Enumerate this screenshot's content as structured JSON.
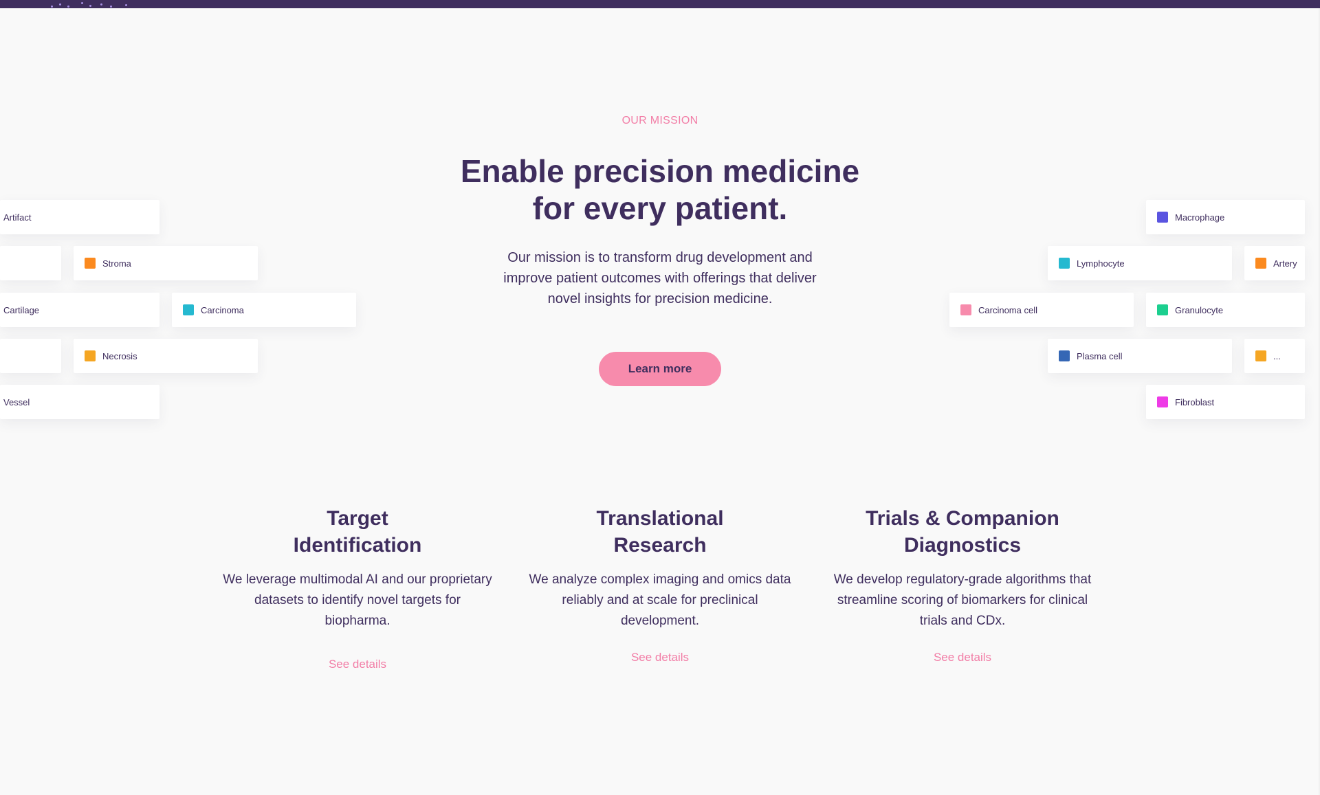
{
  "colors": {
    "brand_dark": "#3f2e5e",
    "accent_pink": "#f27da6",
    "button_pink": "#f78bac",
    "page_bg": "#f9f9f9"
  },
  "mission": {
    "eyebrow": "OUR MISSION",
    "headline_line1": "Enable precision medicine",
    "headline_line2": "for every patient.",
    "description": "Our mission is to transform drug development and improve patient outcomes with offerings that deliver novel insights for precision medicine.",
    "cta_label": "Learn more"
  },
  "tissue_labels": {
    "left": [
      {
        "label": "Artifact",
        "color": null
      },
      {
        "label": "",
        "color": null
      },
      {
        "label": "Stroma",
        "color": "#fb8a1f"
      },
      {
        "label": "Cartilage",
        "color": null
      },
      {
        "label": "Carcinoma",
        "color": "#25b9d0"
      },
      {
        "label": "",
        "color": null
      },
      {
        "label": "Necrosis",
        "color": "#f5a623"
      },
      {
        "label": "Vessel",
        "color": null
      }
    ],
    "right": [
      {
        "label": "Macrophage",
        "color": "#5a54e0"
      },
      {
        "label": "Lymphocyte",
        "color": "#25b9d0"
      },
      {
        "label": "Artery",
        "color": "#fb8a1f"
      },
      {
        "label": "Carcinoma cell",
        "color": "#f78bac"
      },
      {
        "label": "Granulocyte",
        "color": "#1ccf8f"
      },
      {
        "label": "Plasma cell",
        "color": "#3567b5"
      },
      {
        "label": "...",
        "color": "#f5a623"
      },
      {
        "label": "Fibroblast",
        "color": "#ee3be6"
      }
    ]
  },
  "offerings": [
    {
      "title_line1": "Target",
      "title_line2": "Identification",
      "description": "We leverage multimodal AI and our proprietary datasets to identify novel targets for biopharma.",
      "link_label": "See details"
    },
    {
      "title_line1": "Translational",
      "title_line2": "Research",
      "description": "We analyze complex imaging and omics data reliably and at scale for preclinical development.",
      "link_label": "See details"
    },
    {
      "title_line1": "Trials & Companion",
      "title_line2": "Diagnostics",
      "description": "We develop regulatory-grade algorithms that streamline scoring of biomarkers for clinical trials and CDx.",
      "link_label": "See details"
    }
  ]
}
